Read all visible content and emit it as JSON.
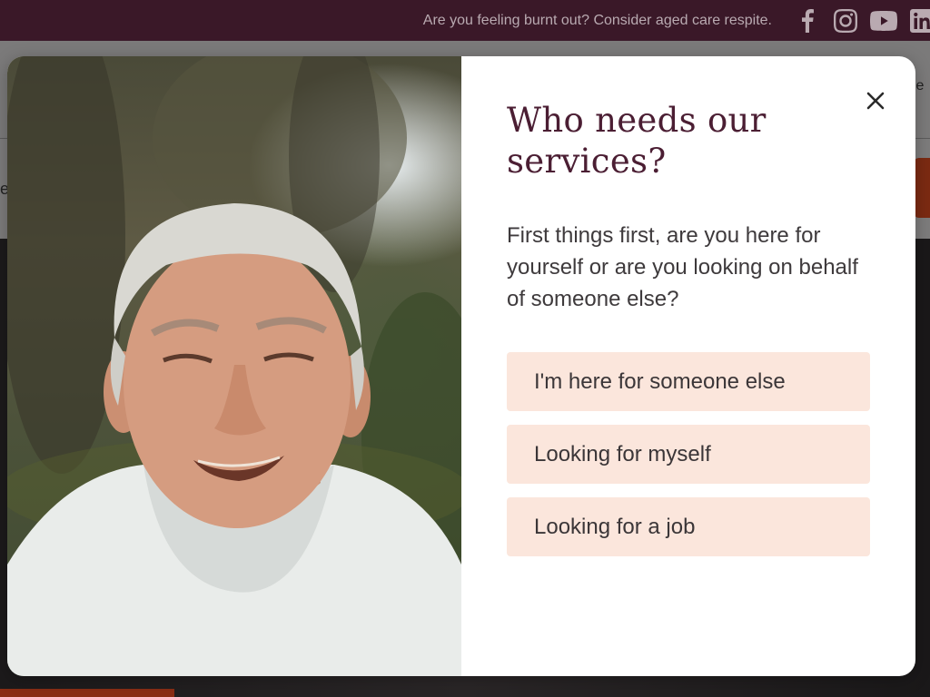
{
  "topbar": {
    "announcement": "Are you feeling burnt out? Consider aged care respite.",
    "social_icons": [
      "facebook-icon",
      "instagram-icon",
      "youtube-icon",
      "linkedin-icon"
    ]
  },
  "background": {
    "nav_fragment": "le",
    "sub_fragment": "e"
  },
  "modal": {
    "title": "Who needs our services?",
    "question": "First things first, are you here for yourself or are you looking on behalf of someone else?",
    "options": [
      {
        "label": "I'm here for someone else"
      },
      {
        "label": "Looking for myself"
      },
      {
        "label": "Looking for a job"
      }
    ],
    "close_icon": "close-icon",
    "image": "photo-elderly-man-smiling"
  },
  "colors": {
    "brand_dark": "#3a1828",
    "title": "#4b1e33",
    "option_bg": "#fbe6dc",
    "cta": "#7b2a12"
  }
}
